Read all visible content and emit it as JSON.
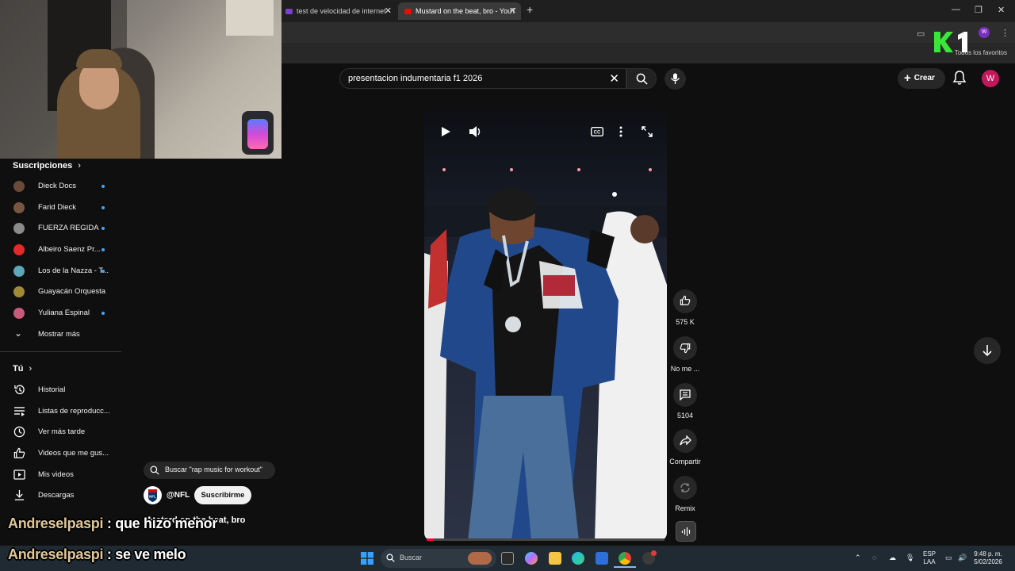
{
  "browser": {
    "tabs": [
      {
        "label": "test de velocidad de internet -",
        "active": false
      },
      {
        "label": "Mustard on the beat, bro - YouT",
        "active": true
      }
    ],
    "new_tab": "+",
    "profile_initial": "W",
    "bookmarks_label": "Todos los favoritos"
  },
  "header": {
    "search_value": "presentacion indumentaria f1 2026",
    "create_label": "Crear",
    "avatar_initial": "W"
  },
  "sidebar": {
    "subscriptions_heading": "Suscripciones",
    "subscriptions": [
      {
        "label": "Dieck Docs",
        "new": true,
        "color": "#6b4a3a"
      },
      {
        "label": "Farid Dieck",
        "new": true,
        "color": "#7a5542"
      },
      {
        "label": "FUERZA REGIDA",
        "new": true,
        "color": "#8a8a8a"
      },
      {
        "label": "Albeiro Saenz Pr...",
        "new": true,
        "color": "#e12a2a"
      },
      {
        "label": "Los de la Nazza - T...",
        "new": true,
        "color": "#5aa8b8"
      },
      {
        "label": "Guayacán Orquesta",
        "new": false,
        "color": "#a08a3a"
      },
      {
        "label": "Yuliana Espinal",
        "new": true,
        "color": "#c85a7a"
      }
    ],
    "show_more_label": "Mostrar más",
    "you_heading": "Tú",
    "you_items": [
      {
        "label": "Historial",
        "icon": "history-icon"
      },
      {
        "label": "Listas de reproducc...",
        "icon": "playlists-icon"
      },
      {
        "label": "Ver más tarde",
        "icon": "watch-later-icon"
      },
      {
        "label": "Videos que me gus...",
        "icon": "liked-icon"
      },
      {
        "label": "Mis videos",
        "icon": "my-videos-icon"
      },
      {
        "label": "Descargas",
        "icon": "downloads-icon"
      }
    ]
  },
  "short": {
    "actions": {
      "likes": "575 K",
      "dislike_label": "No me ...",
      "comments": "5104",
      "share_label": "Compartir",
      "remix_label": "Remix"
    },
    "search_suggestion": "Buscar \"rap music for workout\"",
    "channel_handle": "@NFL",
    "subscribe_label": "Suscribirme",
    "title": "Mustard on the beat, bro",
    "progress": 0.03
  },
  "chat": [
    {
      "user": "Andreselpaspi",
      "message": "que hizo menor"
    },
    {
      "user": "Andreselpaspi",
      "message": "se ve melo"
    }
  ],
  "taskbar": {
    "search_placeholder": "Buscar",
    "lang_top": "ESP",
    "lang_bottom": "LAA",
    "time": "9:48 p. m.",
    "date": "5/02/2026"
  }
}
